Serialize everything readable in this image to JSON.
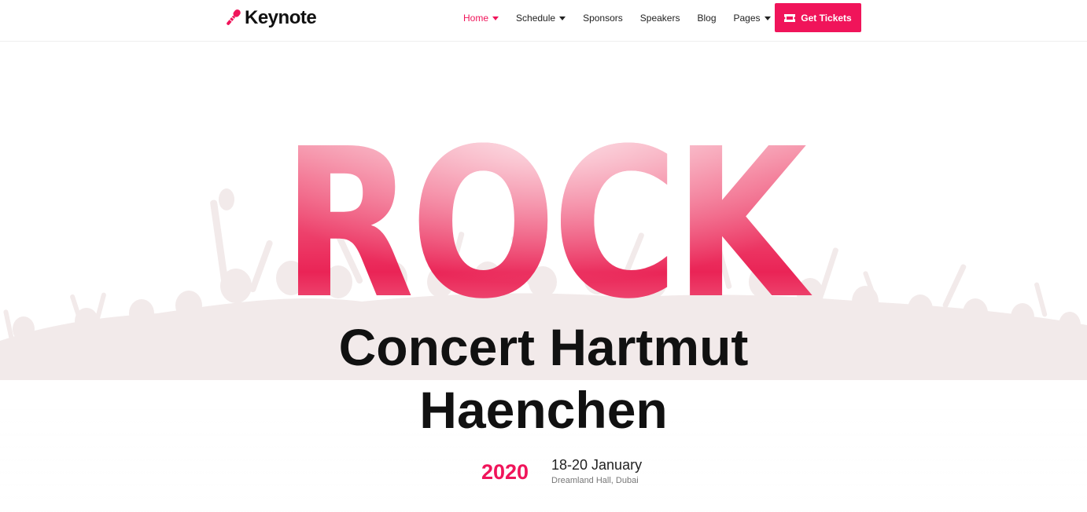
{
  "brand": {
    "name": "Keynote",
    "accent_color": "#f0145a",
    "icon": "microphone-icon"
  },
  "nav": {
    "items": [
      {
        "label": "Home",
        "has_dropdown": true,
        "active": true
      },
      {
        "label": "Schedule",
        "has_dropdown": true,
        "active": false
      },
      {
        "label": "Sponsors",
        "has_dropdown": false,
        "active": false
      },
      {
        "label": "Speakers",
        "has_dropdown": false,
        "active": false
      },
      {
        "label": "Blog",
        "has_dropdown": false,
        "active": false
      },
      {
        "label": "Pages",
        "has_dropdown": true,
        "active": false
      }
    ],
    "cta": {
      "label": "Get Tickets",
      "icon": "ticket-icon"
    }
  },
  "hero": {
    "headline": "ROCK",
    "title_line1": "Concert Hartmut",
    "title_line2": "Haenchen",
    "year": "2020",
    "dates": "18-20 January",
    "venue": "Dreamland Hall, Dubai"
  }
}
